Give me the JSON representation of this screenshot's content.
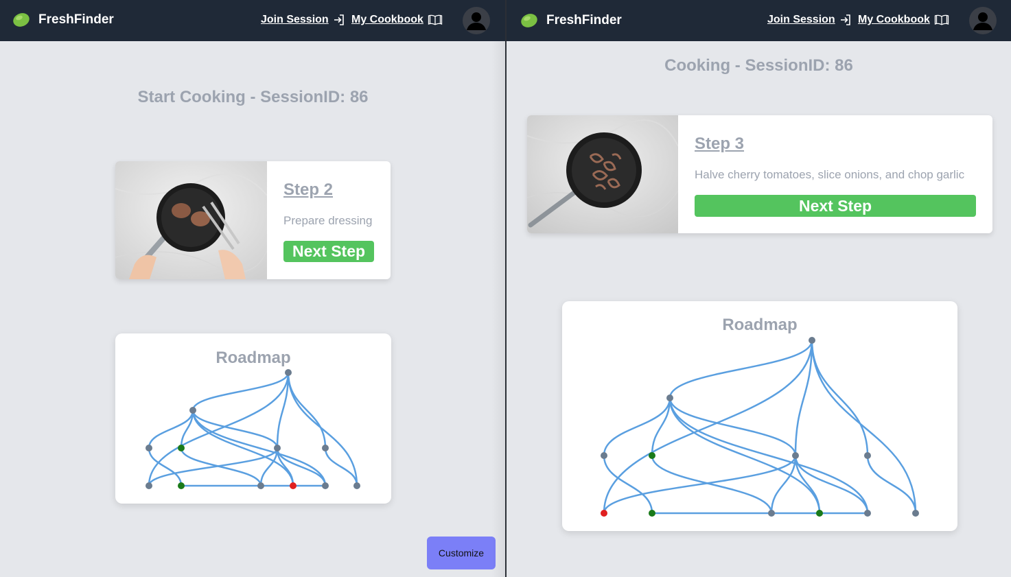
{
  "left": {
    "navbar": {
      "brand": "FreshFinder",
      "join_session": "Join Session",
      "my_cookbook": "My Cookbook"
    },
    "session_title": "Start Cooking - SessionID: 86",
    "step": {
      "title": "Step 2",
      "description": "Prepare dressing",
      "next_label": "Next Step"
    },
    "roadmap": {
      "title": "Roadmap",
      "node_statuses": [
        "default",
        "default",
        "default",
        "completed",
        "default",
        "default",
        "default",
        "completed",
        "default",
        "current",
        "default",
        "default"
      ]
    },
    "customize_label": "Customize"
  },
  "right": {
    "navbar": {
      "brand": "FreshFinder",
      "join_session": "Join Session",
      "my_cookbook": "My Cookbook"
    },
    "session_title": "Cooking - SessionID: 86",
    "step": {
      "title": "Step 3",
      "description": "Halve cherry tomatoes, slice onions, and chop garlic",
      "next_label": "Next Step"
    },
    "roadmap": {
      "title": "Roadmap",
      "node_statuses": [
        "default",
        "default",
        "default",
        "completed",
        "default",
        "default",
        "current",
        "completed",
        "default",
        "completed",
        "default",
        "default"
      ]
    }
  },
  "colors": {
    "navbar": "#1f2937",
    "accent_green": "#54c45e",
    "customize": "#7b7ff7",
    "roadmap_edge": "#5a9fe0",
    "node_default": "#6b7c8f",
    "node_completed": "#1a7a1a",
    "node_current": "#e02020"
  },
  "icons": {
    "logo": "lime-icon",
    "join": "sign-in-icon",
    "cookbook": "open-book-icon",
    "avatar": "user-icon"
  }
}
